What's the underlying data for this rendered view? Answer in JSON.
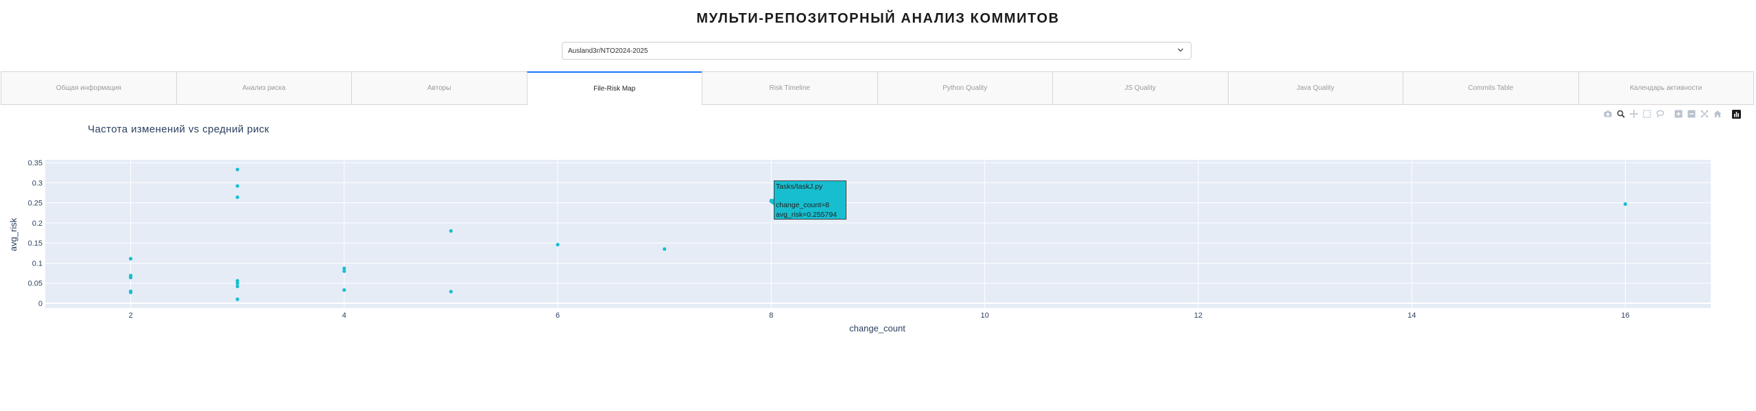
{
  "page": {
    "title": "МУЛЬТИ-РЕПОЗИТОРНЫЙ АНАЛИЗ КОММИТОВ"
  },
  "repo_select": {
    "value": "Ausland3r/NTO2024-2025"
  },
  "tabs": [
    {
      "label": "Общая информация",
      "active": false
    },
    {
      "label": "Анализ риска",
      "active": false
    },
    {
      "label": "Авторы",
      "active": false
    },
    {
      "label": "File-Risk Map",
      "active": true
    },
    {
      "label": "Risk Timeline",
      "active": false
    },
    {
      "label": "Python Quality",
      "active": false
    },
    {
      "label": "JS Quality",
      "active": false
    },
    {
      "label": "Java Quality",
      "active": false
    },
    {
      "label": "Commits Table",
      "active": false
    },
    {
      "label": "Календарь активности",
      "active": false
    }
  ],
  "modebar": {
    "icons": [
      "camera-icon",
      "zoom-icon",
      "pan-icon",
      "box-select-icon",
      "lasso-icon",
      "zoom-in-icon",
      "zoom-out-icon",
      "autoscale-icon",
      "home-icon",
      "plotly-logo-icon"
    ]
  },
  "colors": {
    "marker": "#17becf",
    "plot_bg": "#e5ecf6",
    "accent": "#1975fa"
  },
  "chart_data": {
    "type": "scatter",
    "title": "Частота изменений vs средний риск",
    "xlabel": "change_count",
    "ylabel": "avg_risk",
    "xlim": [
      1.2,
      16.8
    ],
    "ylim": [
      -0.012,
      0.357
    ],
    "x_ticks": [
      2,
      4,
      6,
      8,
      10,
      12,
      14,
      16
    ],
    "y_ticks": [
      0,
      0.05,
      0.1,
      0.15,
      0.2,
      0.25,
      0.3,
      0.35
    ],
    "grid": true,
    "points": [
      {
        "x": 2,
        "y": 0.111
      },
      {
        "x": 2,
        "y": 0.069
      },
      {
        "x": 2,
        "y": 0.064
      },
      {
        "x": 2,
        "y": 0.03
      },
      {
        "x": 2,
        "y": 0.027
      },
      {
        "x": 3,
        "y": 0.333
      },
      {
        "x": 3,
        "y": 0.292
      },
      {
        "x": 3,
        "y": 0.264
      },
      {
        "x": 3,
        "y": 0.056
      },
      {
        "x": 3,
        "y": 0.05
      },
      {
        "x": 3,
        "y": 0.042
      },
      {
        "x": 3,
        "y": 0.01
      },
      {
        "x": 4,
        "y": 0.087
      },
      {
        "x": 4,
        "y": 0.08
      },
      {
        "x": 4,
        "y": 0.033
      },
      {
        "x": 5,
        "y": 0.18
      },
      {
        "x": 5,
        "y": 0.029
      },
      {
        "x": 6,
        "y": 0.146
      },
      {
        "x": 7,
        "y": 0.135
      },
      {
        "x": 8,
        "y": 0.255794
      },
      {
        "x": 16,
        "y": 0.247
      }
    ],
    "hover": {
      "file": "Tasks/taskJ.py",
      "change_count_text": "change_count=8",
      "avg_risk_text": "avg_risk=0.255794"
    }
  }
}
